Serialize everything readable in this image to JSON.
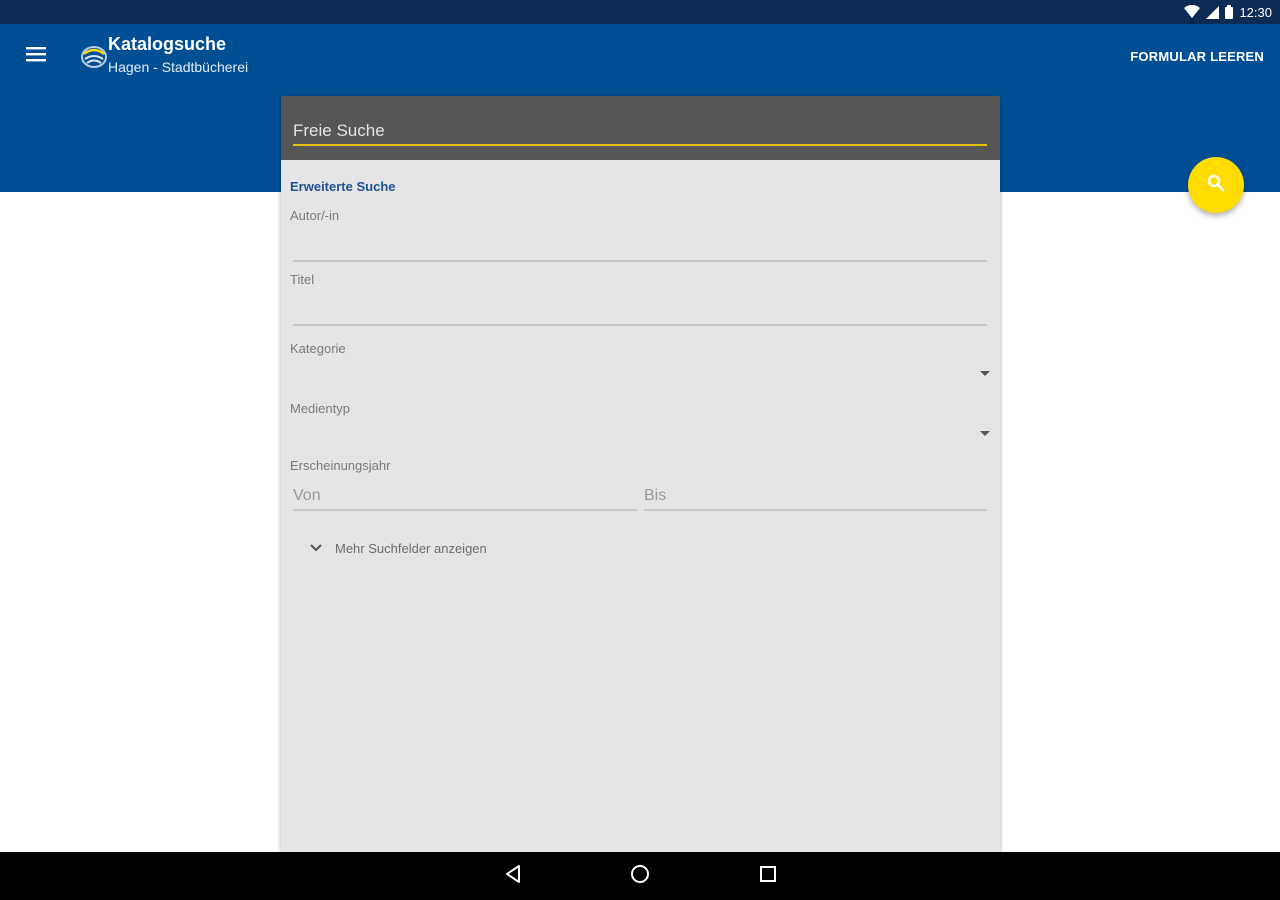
{
  "status_bar": {
    "time": "12:30",
    "icons": [
      "wifi-icon",
      "cellular-signal-icon",
      "battery-icon"
    ]
  },
  "app_bar": {
    "title": "Katalogsuche",
    "subtitle": "Hagen - Stadtbücherei",
    "clear_label": "FORMULAR LEEREN",
    "menu_icon": "hamburger-menu-icon",
    "logo_icon": "library-logo-icon"
  },
  "search": {
    "free_search_placeholder": "Freie Suche",
    "fab_icon": "search-icon"
  },
  "form": {
    "section_title": "Erweiterte Suche",
    "author_label": "Autor/-in",
    "title_label": "Titel",
    "category_label": "Kategorie",
    "category_value": "",
    "media_type_label": "Medientyp",
    "media_type_value": "",
    "year_label": "Erscheinungsjahr",
    "year_from_placeholder": "Von",
    "year_to_placeholder": "Bis",
    "more_fields_label": "Mehr Suchfelder anzeigen"
  },
  "nav_bar": {
    "icons": [
      "back-icon",
      "home-icon",
      "recents-icon"
    ]
  },
  "colors": {
    "app_bar": "#004f95",
    "status_bar": "#0c2c55",
    "accent": "#fedc00",
    "section_title": "#1f4f95"
  }
}
